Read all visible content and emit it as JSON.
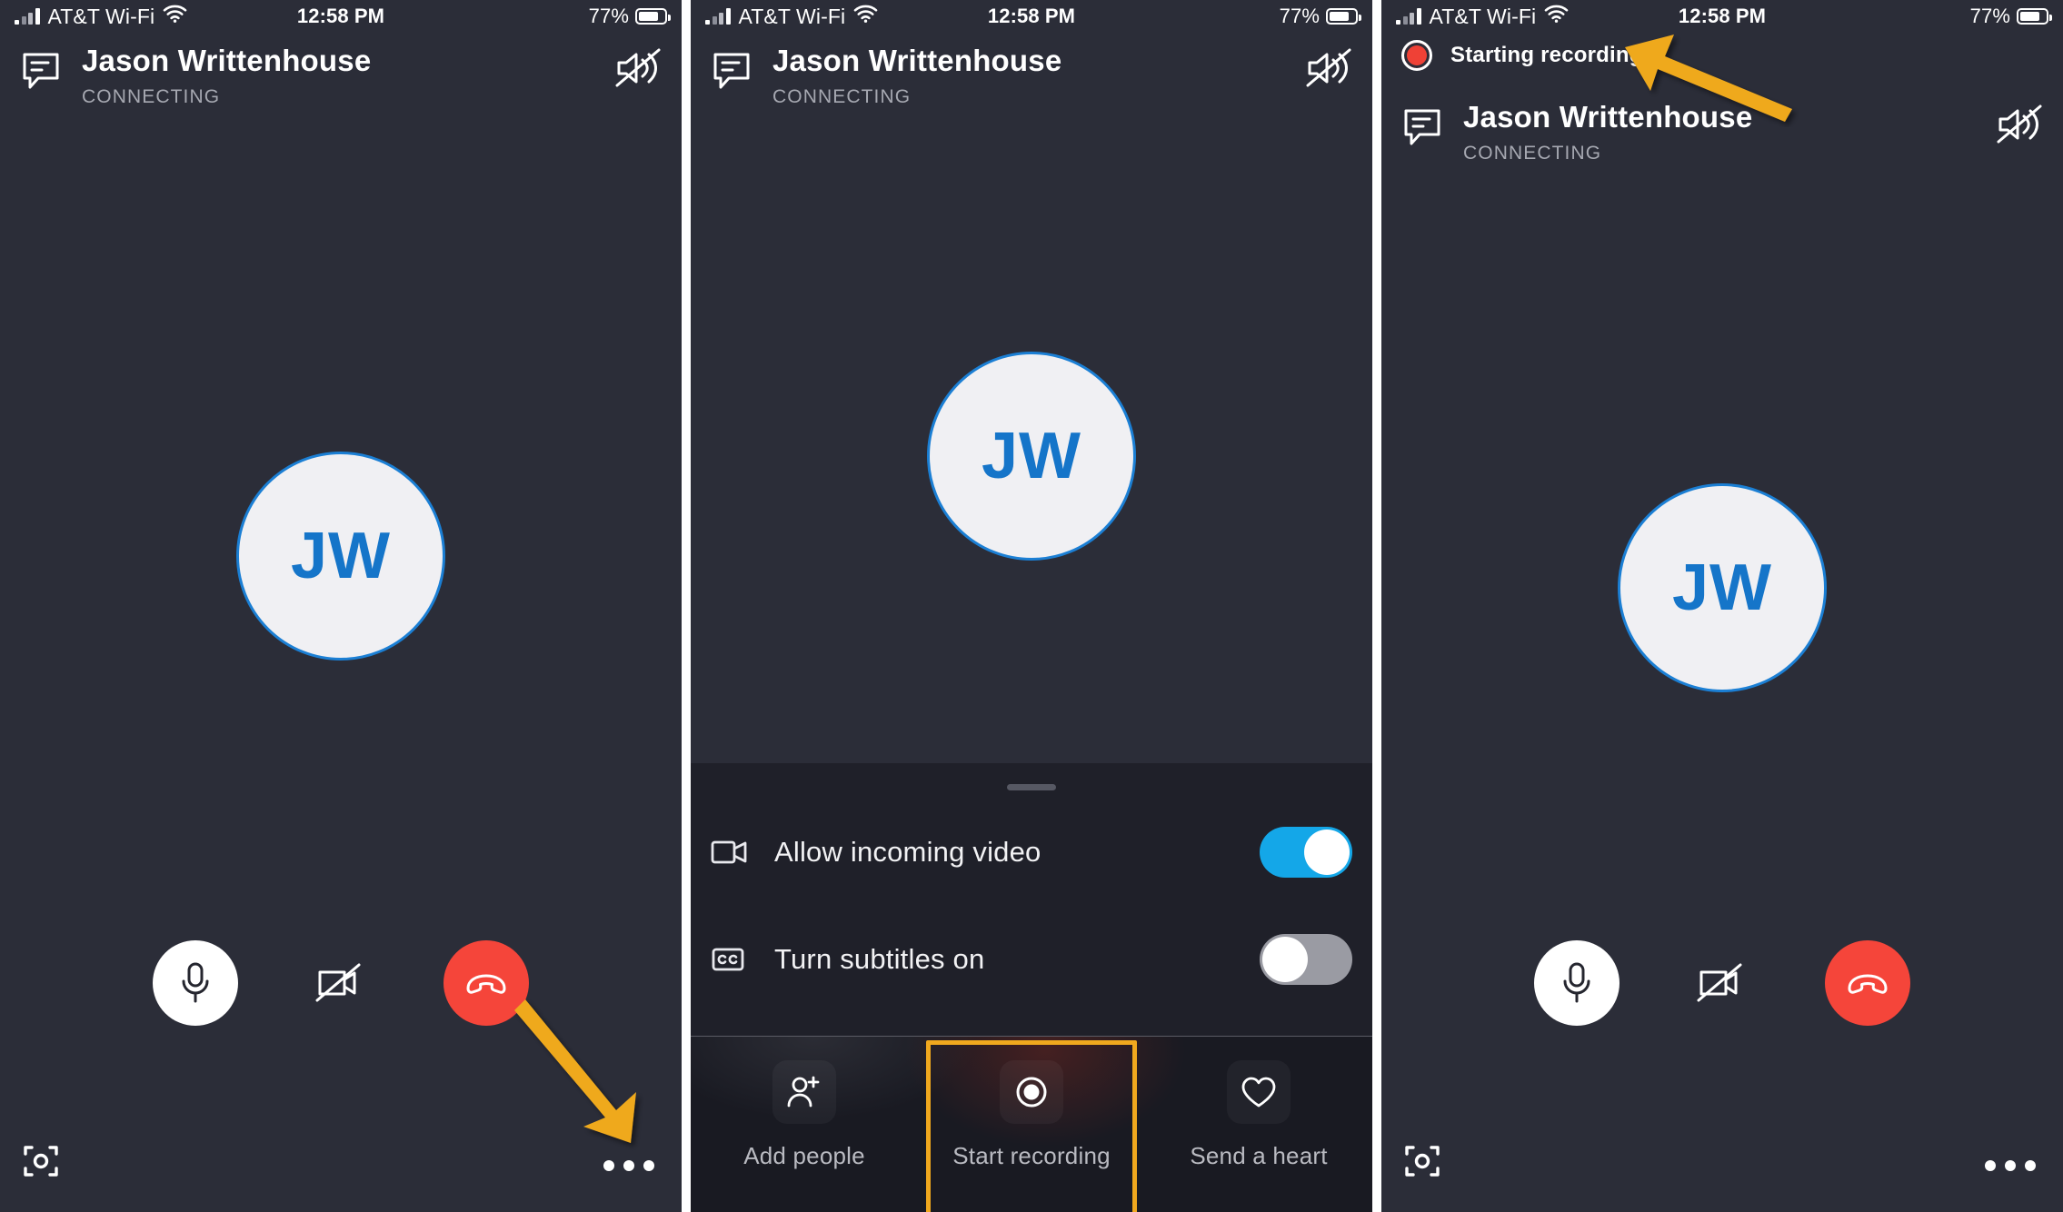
{
  "meta": {
    "app": "Skype call screen (iOS)",
    "accent_orange": "#f0a81e",
    "accent_blue": "#14a7e8",
    "avatar_blue": "#1575c9",
    "end_call_red": "#f5453a",
    "panel_bg": "#2b2d38",
    "sheet_bg": "#1f2029",
    "actionbar_bg": "#191a22"
  },
  "status_bar": {
    "carrier": "AT&T Wi-Fi",
    "signal_icon": "cellular-bars-icon",
    "wifi_icon": "wifi-icon",
    "time": "12:58 PM",
    "battery_percent": "77%",
    "battery_icon": "battery-icon",
    "battery_level": 77
  },
  "call": {
    "chat_icon": "chat-bubble-icon",
    "peer_name": "Jason Writtenhouse",
    "status": "CONNECTING",
    "speaker_icon": "speaker-muted-icon",
    "avatar_initials": "JW",
    "controls": [
      {
        "name": "microphone-button",
        "icon": "microphone-icon",
        "style": "white-round"
      },
      {
        "name": "video-off-button",
        "icon": "video-camera-off-icon",
        "style": "plain"
      },
      {
        "name": "end-call-button",
        "icon": "phone-hangup-icon",
        "style": "red-round"
      }
    ],
    "snapshot_icon": "snapshot-frame-icon",
    "more_icon": "more-options-icon"
  },
  "panels": [
    {
      "id": "panel-1",
      "name": "call-screen-default",
      "has_sheet": false,
      "has_recording_banner": false,
      "annotation_arrow": "arrow-pointing-to-more-options"
    },
    {
      "id": "panel-2",
      "name": "call-screen-options-sheet",
      "has_sheet": true,
      "has_recording_banner": false,
      "annotation_arrow": null
    },
    {
      "id": "panel-3",
      "name": "call-screen-recording-started",
      "has_sheet": false,
      "has_recording_banner": true,
      "annotation_arrow": "arrow-pointing-to-recording-banner"
    }
  ],
  "sheet": {
    "grabber": "sheet-drag-handle",
    "rows": [
      {
        "icon": "video-camera-icon",
        "label": "Allow incoming video",
        "toggle_state": "on",
        "toggle_name": "allow-incoming-video-toggle"
      },
      {
        "icon": "closed-captions-icon",
        "label": "Turn subtitles on",
        "toggle_state": "off",
        "toggle_name": "turn-subtitles-on-toggle"
      }
    ]
  },
  "action_bar": {
    "items": [
      {
        "icon": "add-person-icon",
        "label": "Add people",
        "name": "add-people-button",
        "highlighted": false
      },
      {
        "icon": "record-circle-icon",
        "label": "Start recording",
        "name": "start-recording-button",
        "highlighted": true
      },
      {
        "icon": "heart-icon",
        "label": "Send a heart",
        "name": "send-a-heart-button",
        "highlighted": false
      }
    ]
  },
  "recording_banner": {
    "icon": "recording-dot-icon",
    "label": "Starting recording..."
  }
}
